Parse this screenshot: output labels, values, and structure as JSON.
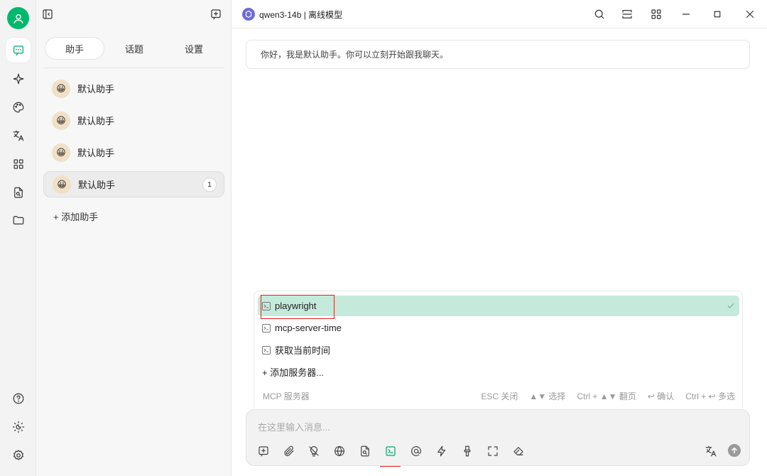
{
  "panel": {
    "tabs": [
      {
        "label": "助手",
        "active": true
      },
      {
        "label": "话题",
        "active": false
      },
      {
        "label": "设置",
        "active": false
      }
    ],
    "assistants": [
      {
        "name": "默认助手",
        "emoji": "😀"
      },
      {
        "name": "默认助手",
        "emoji": "😀"
      },
      {
        "name": "默认助手",
        "emoji": "😀"
      },
      {
        "name": "默认助手",
        "emoji": "😀",
        "badge": "1",
        "active": true
      }
    ],
    "add_assistant": "+ 添加助手"
  },
  "header": {
    "model_name": "qwen3-14b | 离线模型"
  },
  "chat": {
    "greeting": "你好，我是默认助手。你可以立刻开始跟我聊天。"
  },
  "mcp_popup": {
    "items": [
      {
        "label": "playwright",
        "selected": true
      },
      {
        "label": "mcp-server-time",
        "selected": false
      },
      {
        "label": "获取当前时间",
        "selected": false
      }
    ],
    "add_server": "+ 添加服务器...",
    "footer_title": "MCP 服务器",
    "hints": [
      "ESC 关闭",
      "▲▼ 选择",
      "Ctrl + ▲▼ 翻页",
      "↩ 确认",
      "Ctrl + ↩ 多选"
    ]
  },
  "input": {
    "placeholder": "在这里输入消息..."
  },
  "colors": {
    "brand_green": "#00b96b",
    "selected_bg": "#c5eadb",
    "highlight_red": "#e02020"
  }
}
